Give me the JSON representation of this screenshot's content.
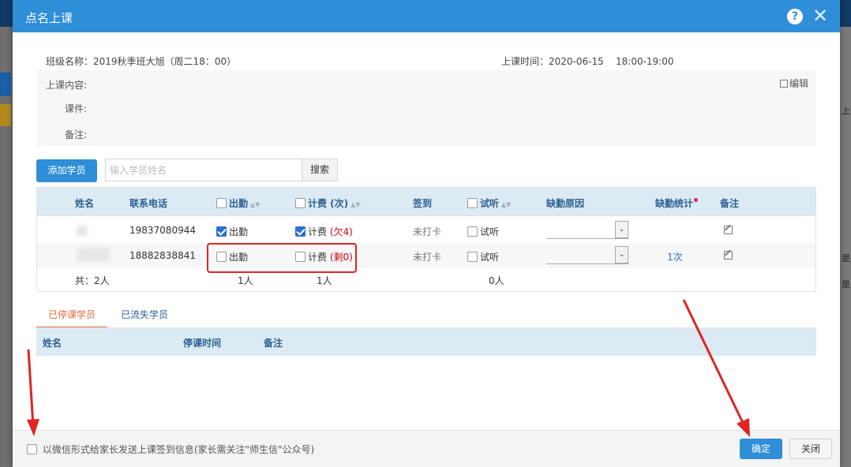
{
  "background": {
    "right_labels": [
      "上",
      "是",
      "是"
    ]
  },
  "modal": {
    "title": "点名上课",
    "help_glyph": "?",
    "close_glyph": "✕"
  },
  "info": {
    "class_label": "班级名称：",
    "class_value": "2019秋季班大旭（周二18：00）",
    "time_label": "上课时间：",
    "time_value": "2020-06-15    18:00-19:00"
  },
  "content": {
    "content_label": "上课内容:",
    "courseware_label": "课件:",
    "remark_label": "备注:",
    "edit_label": "编辑"
  },
  "toolbar": {
    "add_button": "添加学员",
    "search_placeholder": "输入学员姓名",
    "search_button": "搜索"
  },
  "table": {
    "headers": {
      "name": "姓名",
      "phone": "联系电话",
      "attend": "出勤",
      "charge": "计费 (次)",
      "signin": "签到",
      "trial": "试听",
      "absence_reason": "缺勤原因",
      "absence_stats": "缺勤统计",
      "remark": "备注"
    },
    "sort_glyph": "▲▼",
    "rows": [
      {
        "phone": "19837080944",
        "attend_checked": true,
        "attend_label": "出勤",
        "charge_checked": true,
        "charge_label": "计费",
        "charge_note": "(欠4)",
        "signin": "未打卡",
        "trial_label": "试听",
        "absence_stats": ""
      },
      {
        "phone": "18882838841",
        "attend_checked": false,
        "attend_label": "出勤",
        "charge_checked": false,
        "charge_label": "计费",
        "charge_note": "(剩0)",
        "signin": "未打卡",
        "trial_label": "试听",
        "absence_stats": "1次"
      }
    ],
    "summary": {
      "total": "共：2人",
      "attend": "1人",
      "charge": "1人",
      "trial": "0人"
    },
    "select_arrow": "⌄"
  },
  "tabs": {
    "stopped": "已停课学员",
    "lost": "已流失学员"
  },
  "stopped_table": {
    "headers": {
      "name": "姓名",
      "stop_time": "停课时间",
      "remark": "备注"
    }
  },
  "footer": {
    "wechat_label": "以微信形式给家长发送上课签到信息(家长需关注\"师生信\"公众号)",
    "ok_button": "确定",
    "close_button": "关闭"
  },
  "colors": {
    "accent": "#2e8ed8",
    "header_bg": "#dbeaf3",
    "warning_red": "#d0021b",
    "annotation_red": "#e02424"
  }
}
